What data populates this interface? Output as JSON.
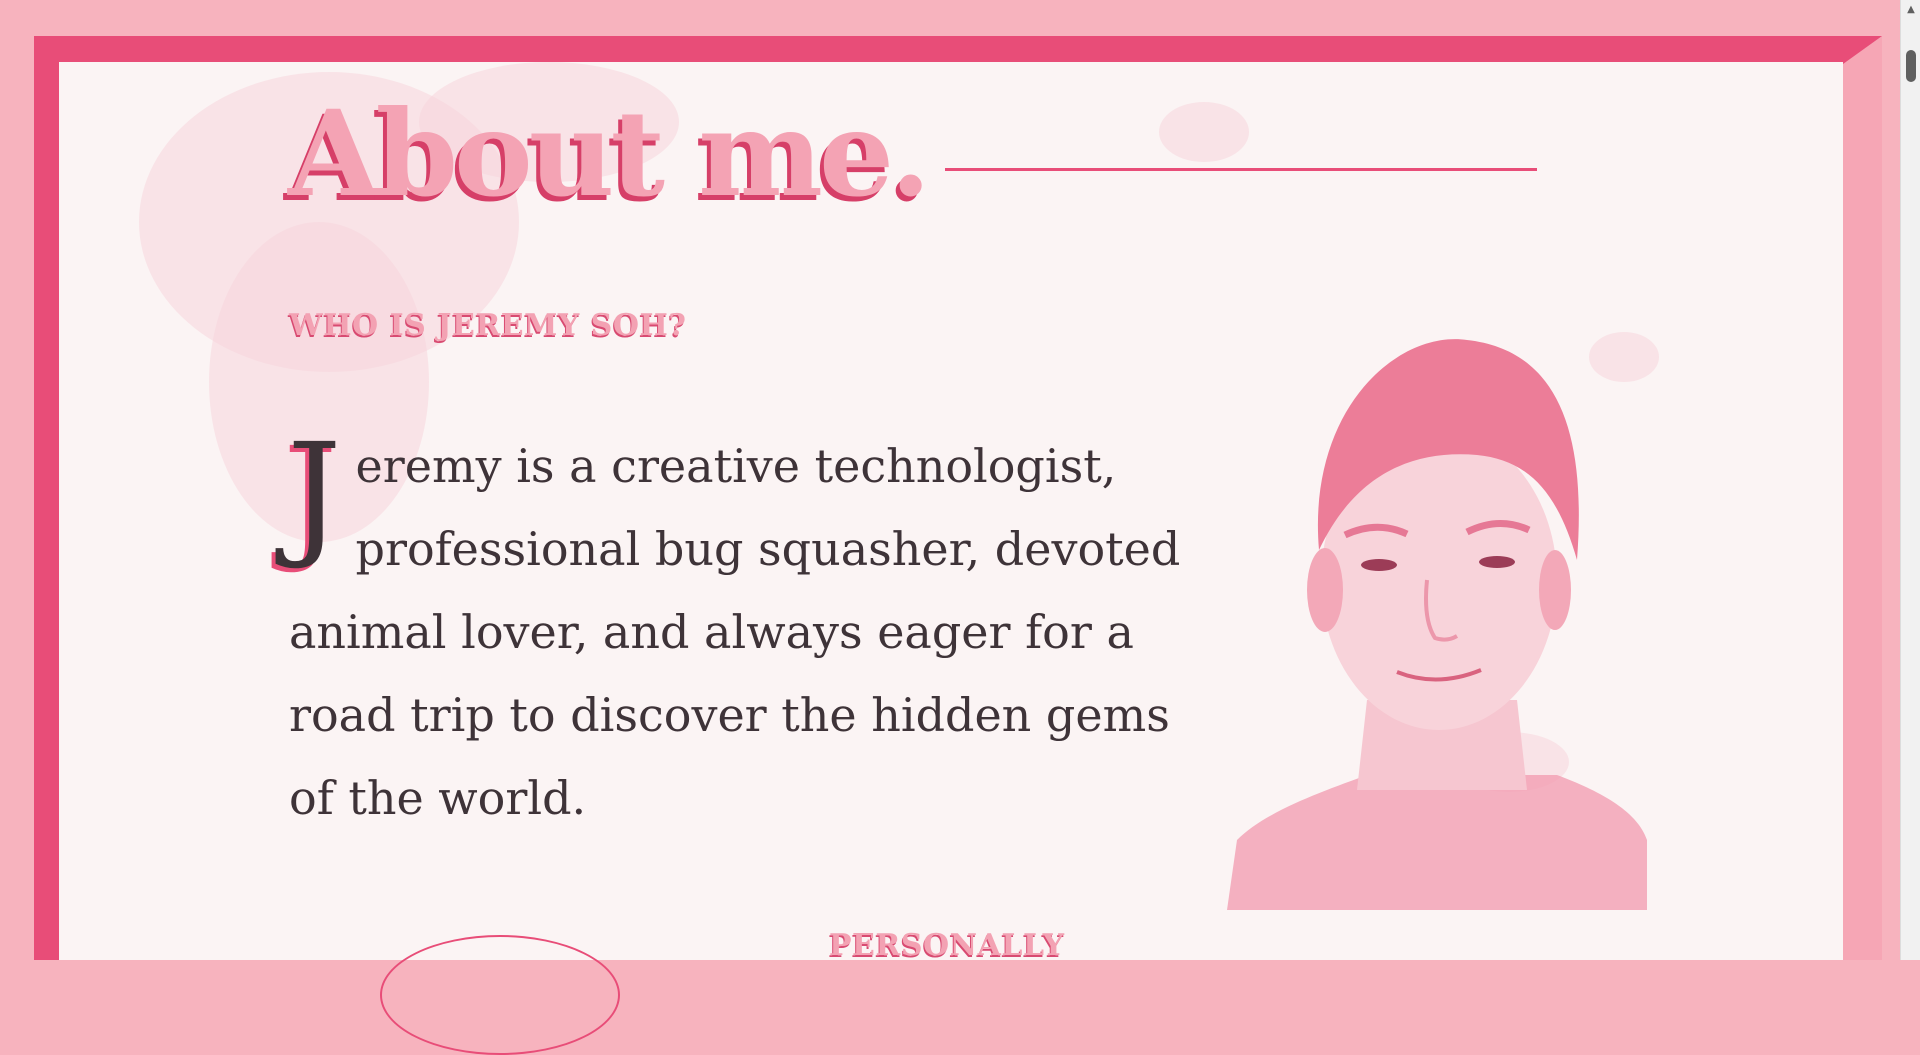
{
  "section": {
    "title": "About me.",
    "subheading": "WHO IS JEREMY SOH?",
    "bio_drop_cap": "J",
    "bio_text": "eremy is a creative technologist, professional bug squasher, devoted animal lover, and always eager for a road trip to discover the hidden gems of the world.",
    "next_subheading": "PERSONALLY"
  },
  "colors": {
    "frame_light": "#f7b3be",
    "frame_dark": "#e84d78",
    "paper": "#fbf4f4",
    "title_fill": "#f4a3b4",
    "body_text": "#3e3338"
  },
  "icons": {
    "scroll_up": "chevron-up-icon"
  }
}
